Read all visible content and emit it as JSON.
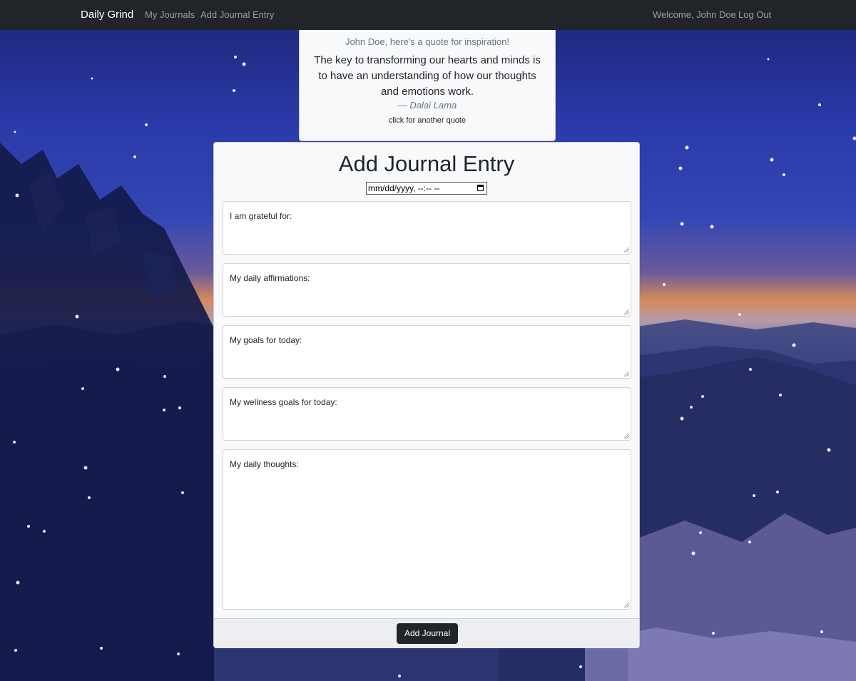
{
  "navbar": {
    "brand": "Daily Grind",
    "links": [
      "My Journals",
      "Add Journal Entry"
    ],
    "welcome": "Welcome, John Doe",
    "logout": "Log Out"
  },
  "quote": {
    "heading": "John Doe, here's a quote for inspiration!",
    "text": "The key to transforming our hearts and minds is to have an understanding of how our thoughts and emotions work.",
    "author": "— Dalai Lama",
    "refresh_link": "click for another quote"
  },
  "form": {
    "title": "Add Journal Entry",
    "date_placeholder": "mm/dd/yyyy, --:-- --",
    "fields": [
      {
        "placeholder": "I am grateful for:"
      },
      {
        "placeholder": "My daily affirmations:"
      },
      {
        "placeholder": "My goals for today:"
      },
      {
        "placeholder": "My wellness goals for today:"
      },
      {
        "placeholder": "My daily thoughts:"
      }
    ],
    "submit_label": "Add Journal"
  },
  "colors": {
    "navbar": "#212529",
    "card": "#f8f9fa",
    "button": "#212529"
  }
}
